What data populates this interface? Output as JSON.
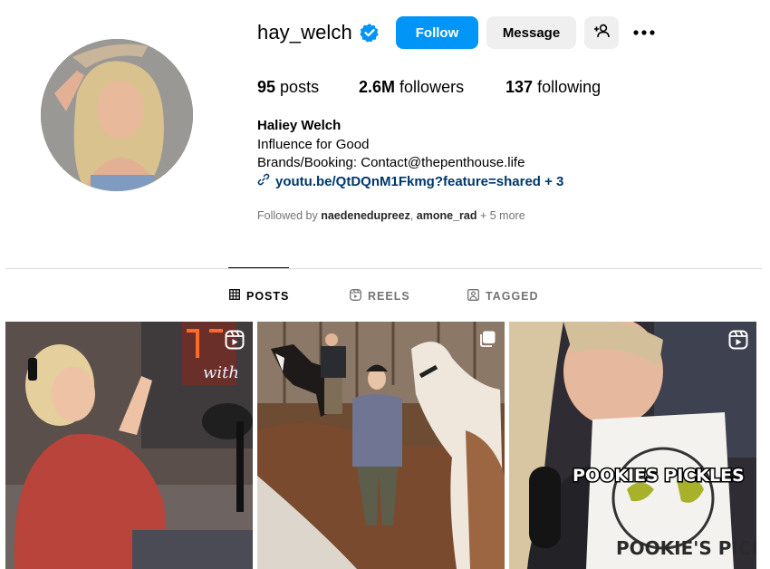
{
  "profile": {
    "username": "hay_welch",
    "verified": true,
    "follow_label": "Follow",
    "message_label": "Message"
  },
  "stats": {
    "posts_count": "95",
    "posts_label": "posts",
    "followers_count": "2.6M",
    "followers_label": "followers",
    "following_count": "137",
    "following_label": "following"
  },
  "bio": {
    "name": "Haliey Welch",
    "line1": "Influence for Good",
    "line2": "Brands/Booking: Contact@thepenthouse.life",
    "link": "youtu.be/QtDQnM1Fkmg?feature=shared + 3"
  },
  "followed_by": {
    "prefix": "Followed by",
    "user1": "naedenedupreez",
    "sep": ",",
    "user2": "amone_rad",
    "suffix": "+ 5 more"
  },
  "tabs": [
    {
      "label": "POSTS",
      "icon": "grid-icon",
      "active": true
    },
    {
      "label": "REELS",
      "icon": "reels-icon",
      "active": false
    },
    {
      "label": "TAGGED",
      "icon": "tagged-icon",
      "active": false
    }
  ],
  "posts": [
    {
      "type": "reel",
      "badge_icon": "reels-icon"
    },
    {
      "type": "carousel",
      "badge_icon": "carousel-icon"
    },
    {
      "type": "reel",
      "badge_icon": "reels-icon",
      "overlay_text": "POOKIES PICKLES",
      "sign_text": "POOKIE'S PICKLES"
    }
  ],
  "colors": {
    "accent": "#0095f6",
    "verified_badge": "#0095f6",
    "link": "#00376b",
    "secondary_text": "#737373",
    "button_gray": "#efefef"
  }
}
